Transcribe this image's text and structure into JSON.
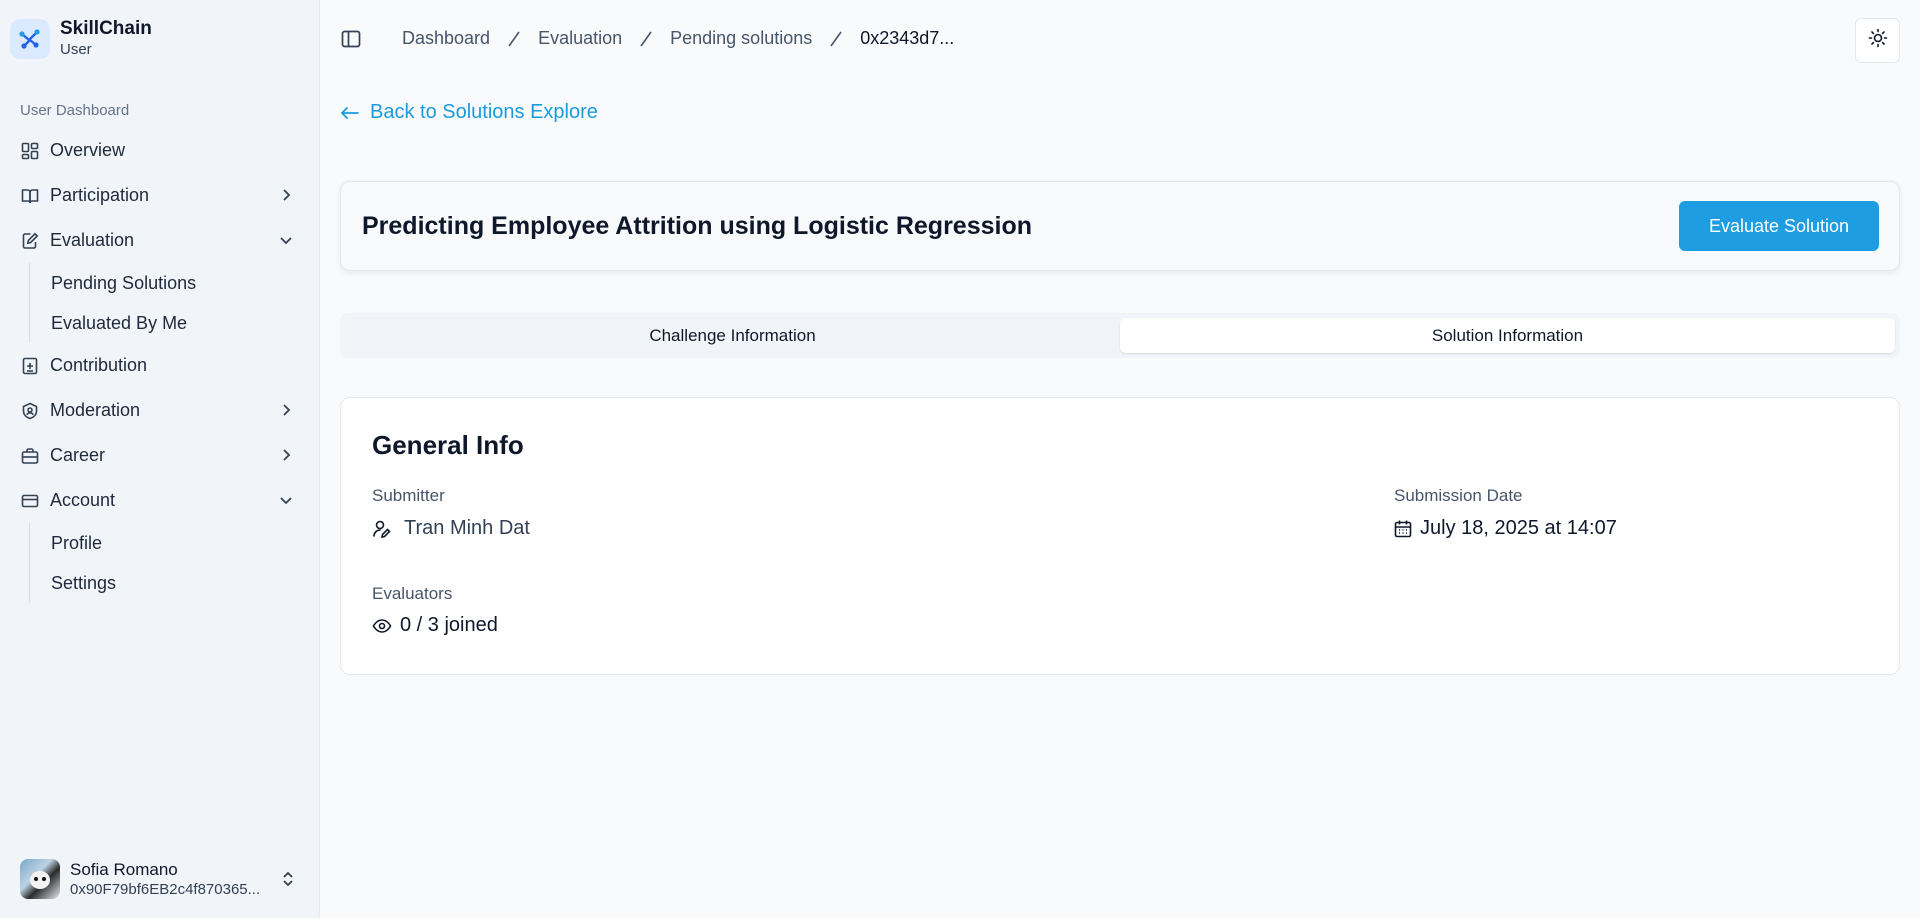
{
  "sidebar": {
    "brand": {
      "name": "SkillChain",
      "role": "User"
    },
    "section_label": "User Dashboard",
    "items": [
      {
        "label": "Overview",
        "icon": "layout-grid-icon",
        "chevron": ""
      },
      {
        "label": "Participation",
        "icon": "book-open-icon",
        "chevron": "right"
      },
      {
        "label": "Evaluation",
        "icon": "edit-document-icon",
        "chevron": "down",
        "children": [
          {
            "label": "Pending Solutions"
          },
          {
            "label": "Evaluated By Me"
          }
        ]
      },
      {
        "label": "Contribution",
        "icon": "file-plus-icon",
        "chevron": ""
      },
      {
        "label": "Moderation",
        "icon": "shield-icon",
        "chevron": "right"
      },
      {
        "label": "Career",
        "icon": "briefcase-icon",
        "chevron": "right"
      },
      {
        "label": "Account",
        "icon": "credit-card-icon",
        "chevron": "down",
        "children": [
          {
            "label": "Profile"
          },
          {
            "label": "Settings"
          }
        ]
      }
    ],
    "user": {
      "name": "Sofia Romano",
      "address": "0x90F79bf6EB2c4f870365..."
    }
  },
  "header": {
    "breadcrumbs": [
      "Dashboard",
      "Evaluation",
      "Pending solutions",
      "0x2343d7..."
    ]
  },
  "main": {
    "back_label": "Back to Solutions Explore",
    "title": "Predicting Employee Attrition using Logistic Regression",
    "evaluate_label": "Evaluate Solution",
    "tabs": [
      {
        "label": "Challenge Information",
        "active": false
      },
      {
        "label": "Solution Information",
        "active": true
      }
    ],
    "general_info": {
      "heading": "General Info",
      "submitter_label": "Submitter",
      "submitter": "Tran Minh Dat",
      "submission_date_label": "Submission Date",
      "submission_date": "July 18, 2025 at 14:07",
      "evaluators_label": "Evaluators",
      "evaluators": "0 / 3 joined"
    }
  },
  "colors": {
    "accent": "#1e9de3",
    "link": "#1a9bdc",
    "sidebar_bg": "#f1f5f9",
    "page_bg": "#f8fafc"
  }
}
